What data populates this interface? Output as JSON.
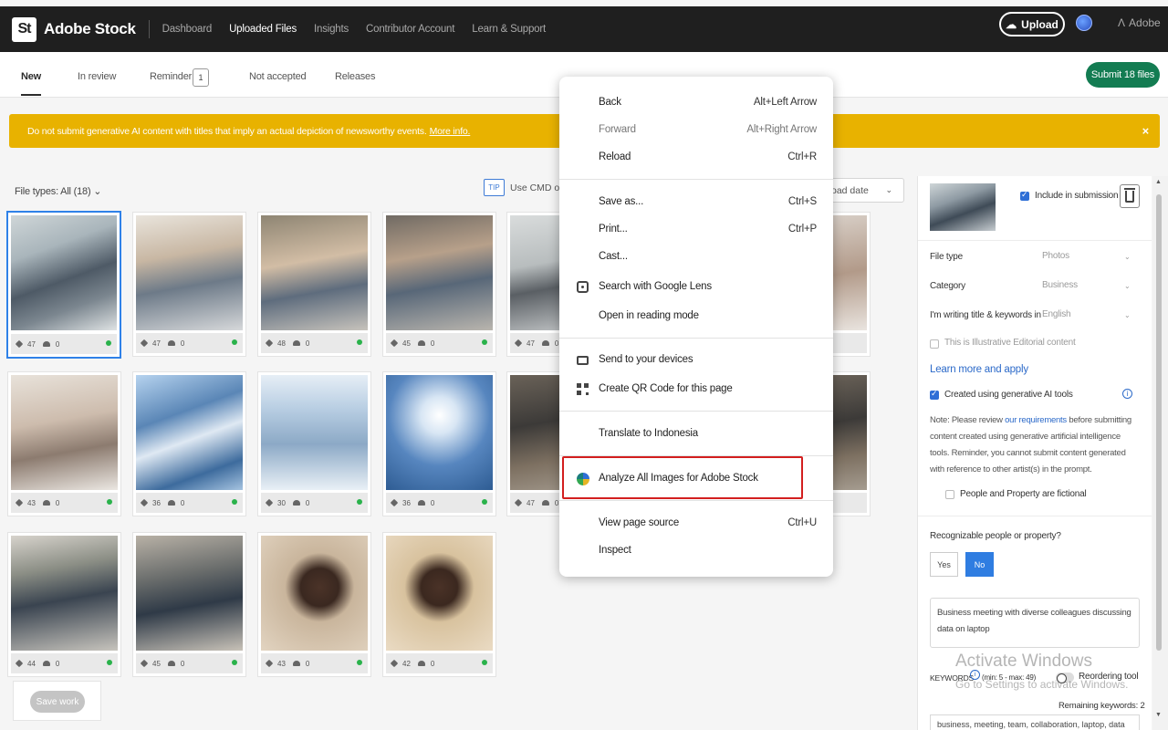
{
  "nav": {
    "logo": "St",
    "brand": "Adobe Stock",
    "links": [
      "Dashboard",
      "Uploaded Files",
      "Insights",
      "Contributor Account",
      "Learn & Support"
    ],
    "upload": "Upload",
    "adobe": "Adobe"
  },
  "tabs": {
    "new": "New",
    "in_review": "In review",
    "reminder": "Reminder",
    "reminder_count": "1",
    "not_accepted": "Not accepted",
    "releases": "Releases",
    "submit": "Submit 18 files"
  },
  "alert": {
    "text": "Do not submit generative AI content with titles that imply an actual depiction of newsworthy events.",
    "link": "More info.",
    "close": "×"
  },
  "filters": {
    "file_types": "File types: All (18)",
    "tip": "TIP",
    "tip_text": "Use CMD or C",
    "sort": "oad date"
  },
  "thumbs": [
    {
      "kw": "47",
      "rel": "0"
    },
    {
      "kw": "47",
      "rel": "0"
    },
    {
      "kw": "48",
      "rel": "0"
    },
    {
      "kw": "45",
      "rel": "0"
    },
    {
      "kw": "47",
      "rel": "0"
    },
    {
      "kw": "43",
      "rel": "0"
    },
    {
      "kw": "36",
      "rel": "0"
    },
    {
      "kw": "30",
      "rel": "0"
    },
    {
      "kw": "36",
      "rel": "0"
    },
    {
      "kw": "47",
      "rel": "0"
    },
    {
      "kw": "44",
      "rel": "0"
    },
    {
      "kw": "45",
      "rel": "0"
    },
    {
      "kw": "43",
      "rel": "0"
    },
    {
      "kw": "42",
      "rel": "0"
    }
  ],
  "save_work": "Save work",
  "panel": {
    "include": "Include in submission",
    "file_type_label": "File type",
    "file_type_value": "Photos",
    "category_label": "Category",
    "category_value": "Business",
    "language_label": "I'm writing title & keywords in",
    "language_value": "English",
    "editorial": "This is Illustrative Editorial content",
    "learn_more": "Learn more and apply",
    "gen_ai": "Created using generative AI tools",
    "info": "i",
    "note_prefix": "Note: Please review",
    "note_link": "our requirements",
    "note_suffix": "before submitting content created using generative artificial intelligence tools. Reminder, you cannot submit content generated with reference to other artist(s) in the prompt.",
    "fictional": "People and Property are fictional",
    "recognizable": "Recognizable people or property?",
    "yes": "Yes",
    "no": "No",
    "title": "Business meeting with diverse colleagues discussing data on laptop",
    "keywords_label": "KEYWORDS",
    "keywords_hint": "(min: 5 - max: 49)",
    "reordering": "Reordering tool",
    "remaining": "Remaining keywords: 2",
    "keywords_value": "business, meeting, team, collaboration, laptop, data"
  },
  "watermark": {
    "line1": "Activate Windows",
    "line2": "Go to Settings to activate Windows."
  },
  "context_menu": {
    "back": "Back",
    "back_sc": "Alt+Left Arrow",
    "forward": "Forward",
    "forward_sc": "Alt+Right Arrow",
    "reload": "Reload",
    "reload_sc": "Ctrl+R",
    "save_as": "Save as...",
    "save_as_sc": "Ctrl+S",
    "print": "Print...",
    "print_sc": "Ctrl+P",
    "cast": "Cast...",
    "lens": "Search with Google Lens",
    "reading": "Open in reading mode",
    "send": "Send to your devices",
    "qr": "Create QR Code for this page",
    "translate": "Translate to Indonesia",
    "analyze": "Analyze All Images for Adobe Stock",
    "view_source": "View page source",
    "view_source_sc": "Ctrl+U",
    "inspect": "Inspect"
  }
}
